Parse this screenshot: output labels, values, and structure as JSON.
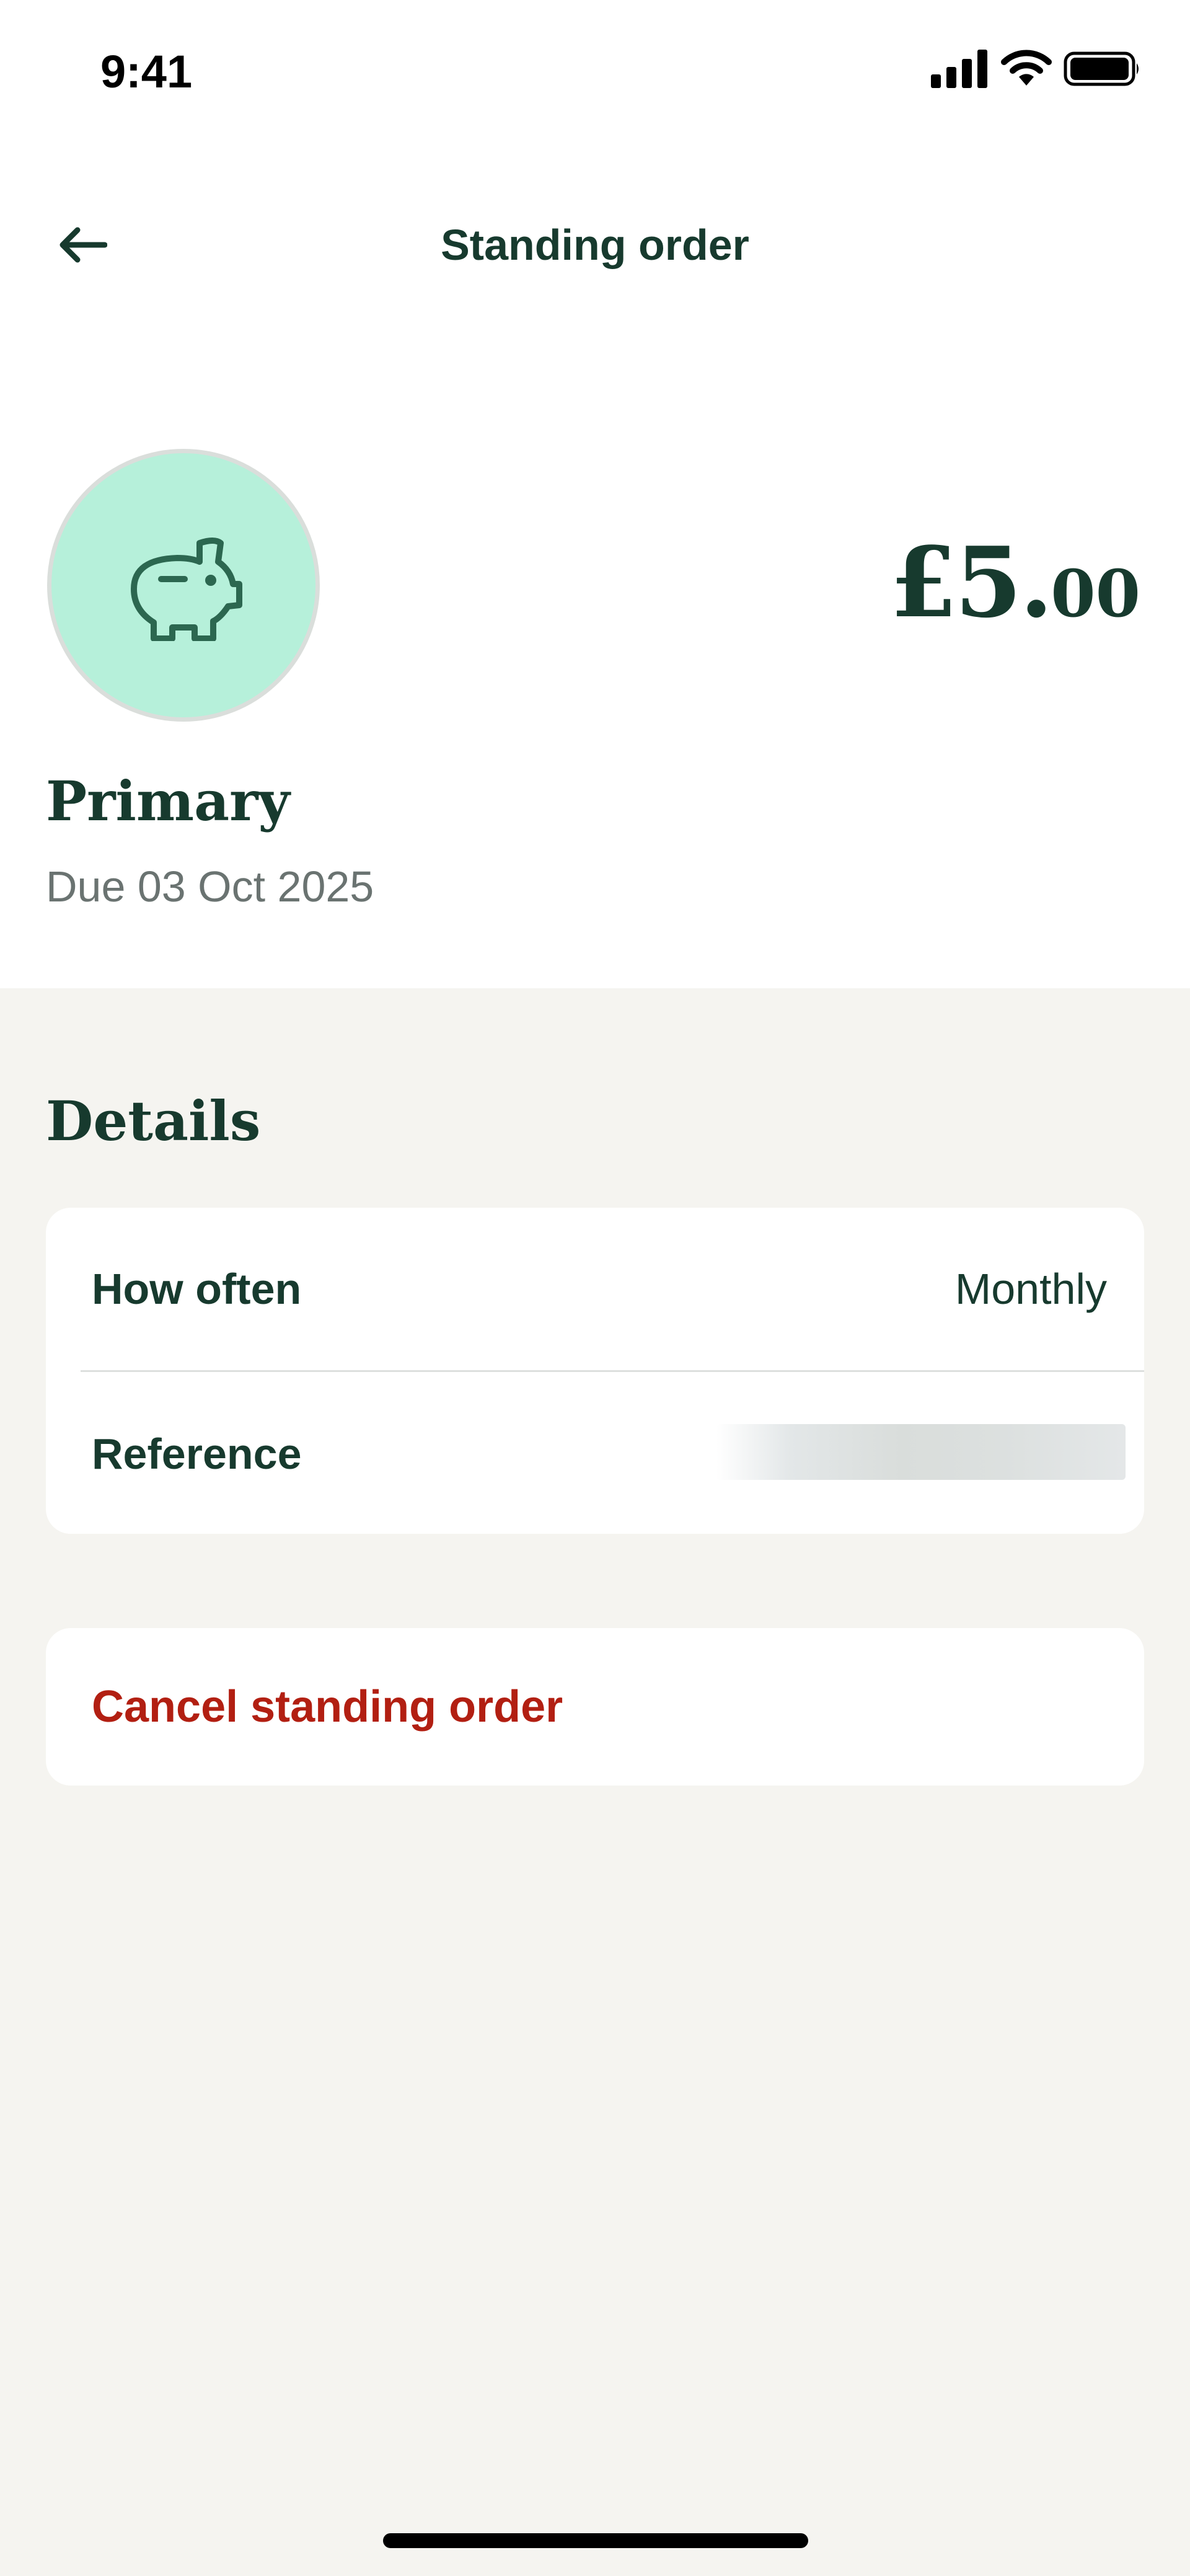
{
  "status_bar": {
    "time": "9:41",
    "icons": [
      "signal-icon",
      "wifi-icon",
      "battery-icon"
    ]
  },
  "header": {
    "title": "Standing order",
    "back_icon": "arrow-left-icon"
  },
  "hero": {
    "avatar_icon": "piggy-bank-icon",
    "amount_major": "£5.",
    "amount_minor": "00",
    "account_name": "Primary",
    "due": "Due 03 Oct 2025"
  },
  "details": {
    "title": "Details",
    "rows": [
      {
        "label": "How often",
        "value": "Monthly"
      },
      {
        "label": "Reference",
        "value": ""
      }
    ]
  },
  "actions": {
    "cancel_label": "Cancel standing order"
  },
  "colors": {
    "background": "#F5F4F0",
    "surface": "#FFFFFF",
    "text_primary": "#173A2E",
    "text_secondary": "#6A7371",
    "avatar_fill": "#B6F0DA",
    "destructive": "#B21F12"
  }
}
